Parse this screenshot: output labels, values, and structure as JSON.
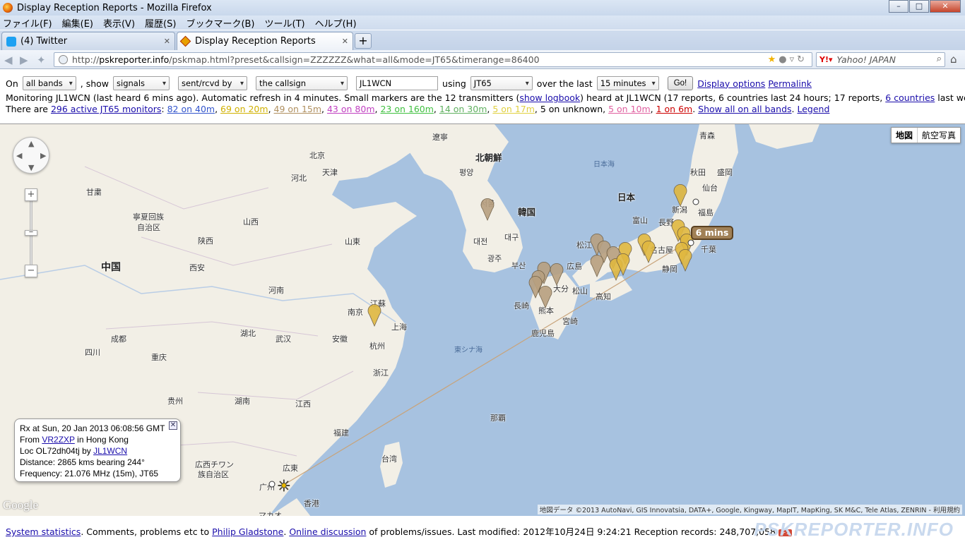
{
  "window": {
    "title": "Display Reception Reports - Mozilla Firefox",
    "buttons": [
      "–",
      "□",
      "✕"
    ]
  },
  "menu": [
    "ファイル(F)",
    "編集(E)",
    "表示(V)",
    "履歴(S)",
    "ブックマーク(B)",
    "ツール(T)",
    "ヘルプ(H)"
  ],
  "tabs": [
    {
      "label": "(4) Twitter",
      "active": false
    },
    {
      "label": "Display Reception Reports",
      "active": true
    }
  ],
  "nav": {
    "url_scheme": "http://",
    "url_host": "pskreporter.info",
    "url_path": "/pskmap.html?preset&callsign=ZZZZZZ&what=all&mode=JT65&timerange=86400",
    "search_placeholder": "Yahoo! JAPAN"
  },
  "controls": {
    "on_label": "On",
    "band": "all bands",
    "show_label": ", show",
    "what": "signals",
    "direction": "sent/rcvd by",
    "who": "the callsign",
    "callsign": "JL1WCN",
    "using_label": "using",
    "mode": "JT65",
    "over_label": "over the last",
    "timerange": "15 minutes",
    "go_button": "Go!",
    "display_options": "Display options",
    "permalink": "Permalink"
  },
  "status": {
    "monitoring": "Monitoring JL1WCN (last heard 6 mins ago). Automatic refresh in 4 minutes. Small markers are the 12 transmitters (",
    "show_logbook": "show logbook",
    "heard_at": ") heard at JL1WCN (17 reports, 6 countries last 24 hours; 17 reports, ",
    "countries_link": "6 countries",
    "last_week": " last week).",
    "there_are": "There are ",
    "active_monitors": "296 active JT65 monitors",
    "colon": ": ",
    "band_40": "82 on 40m",
    "band_20": "69 on 20m",
    "band_15": "49 on 15m",
    "band_80": "43 on 80m",
    "band_160": "23 on 160m",
    "band_30": "14 on 30m",
    "band_17": "5 on 17m",
    "unknown": ", 5 on unknown, ",
    "band_10": "5 on 10m",
    "band_6": "1 on 6m",
    "show_all": "Show all on all bands",
    "legend": "Legend"
  },
  "map": {
    "type_map": "地図",
    "type_sat": "航空写真",
    "labels": {
      "liaoning": "遼寧",
      "north_korea": "北朝鮮",
      "sea_of_japan": "日本海",
      "aomori": "青森",
      "beijing": "北京",
      "tianjin": "天津",
      "pyongyang": "평양",
      "akita": "秋田",
      "morioka": "盛岡",
      "hebei": "河北",
      "sendai": "仙台",
      "japan": "日本",
      "gansu": "甘粛",
      "seoul": "서울",
      "korea": "韓国",
      "niigata": "新潟",
      "fukushima": "福島",
      "ningxia1": "寧夏回族",
      "ningxia2": "自治区",
      "shanxi": "山西",
      "shandong": "山東",
      "daejeon": "대전",
      "daegu": "대구",
      "toyama": "富山",
      "nagano": "長野",
      "shaanxi": "陕西",
      "matsue": "松江",
      "nagoya": "名古屋",
      "chiba": "千葉",
      "china": "中国",
      "xian": "西安",
      "gwangju": "광주",
      "busan": "부산",
      "hiroshima": "広島",
      "shizuoka": "静岡",
      "henan": "河南",
      "oita": "大分",
      "matsuyama": "松山",
      "kochi": "高知",
      "nagasaki": "長崎",
      "kumamoto": "熊本",
      "nanjing": "南京",
      "jiangsu": "江蘇",
      "shanghai": "上海",
      "miyazaki": "宮崎",
      "hubei": "湖北",
      "wuhan": "武汉",
      "anhui": "安徽",
      "kagoshima": "鹿児島",
      "chengdu": "成都",
      "hangzhou": "杭州",
      "east_china_sea": "東シナ海",
      "sichuan": "四川",
      "chongqing": "重庆",
      "zhejiang": "浙江",
      "guizhou": "贵州",
      "hunan": "湖南",
      "jiangxi": "江西",
      "naha": "那覇",
      "fujian": "福建",
      "taiwan": "台湾",
      "guangxi1": "広西チワン",
      "guangxi2": "族自治区",
      "guangdong": "広東",
      "guangzhou": "广州",
      "hongkong": "香港",
      "macau": "マカオ"
    },
    "popup": {
      "rx": "Rx at Sun, 20 Jan 2013 06:08:56 GMT",
      "from_label": "From ",
      "from_call": "VR2ZXP",
      "from_loc": " in Hong Kong",
      "loc_label": "Loc OL72dh04tj by ",
      "loc_call": "JL1WCN",
      "distance": "Distance: 2865 kms bearing 244°",
      "frequency": "Frequency: 21.076 MHz (15m), JT65"
    },
    "time_badge": "6 mins",
    "google": "Google",
    "attribution": "地図データ ©2013 AutoNavi, GIS Innovatsia, DATA+, Google, Kingway, MapIT, MapKing, SK M&C, Tele Atlas, ZENRIN - 利用規約",
    "colors": {
      "sea": "#a7c2e0",
      "land": "#f2efe6",
      "marker_tan": "#b8a080",
      "marker_gold": "#e0b840"
    }
  },
  "footer": {
    "sys_stats": "System statistics",
    "comments": ". Comments, problems etc to ",
    "author": "Philip Gladstone",
    "dot": ". ",
    "discussion": "Online discussion",
    "rest": " of problems/issues. Last modified: 2012年10月24日 9:24:21 Reception records: 248,707,058",
    "gplus": "+1",
    "brand": "PSKREPORTER.INFO"
  }
}
